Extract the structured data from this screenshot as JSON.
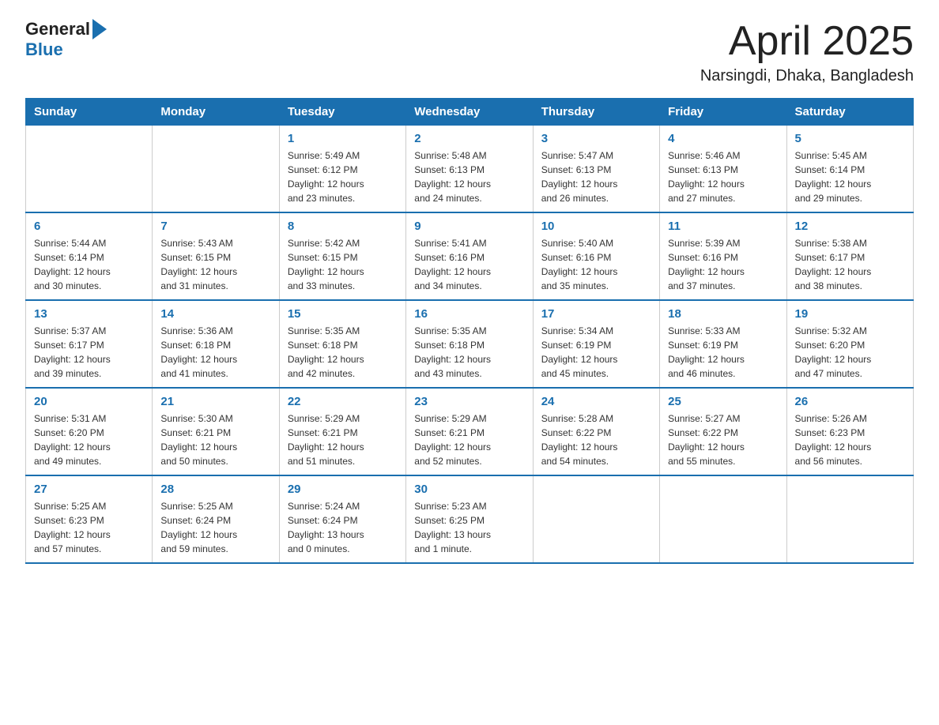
{
  "header": {
    "logo_general": "General",
    "logo_blue": "Blue",
    "month_title": "April 2025",
    "location": "Narsingdi, Dhaka, Bangladesh"
  },
  "weekdays": [
    "Sunday",
    "Monday",
    "Tuesday",
    "Wednesday",
    "Thursday",
    "Friday",
    "Saturday"
  ],
  "weeks": [
    [
      {
        "day": "",
        "info": ""
      },
      {
        "day": "",
        "info": ""
      },
      {
        "day": "1",
        "info": "Sunrise: 5:49 AM\nSunset: 6:12 PM\nDaylight: 12 hours\nand 23 minutes."
      },
      {
        "day": "2",
        "info": "Sunrise: 5:48 AM\nSunset: 6:13 PM\nDaylight: 12 hours\nand 24 minutes."
      },
      {
        "day": "3",
        "info": "Sunrise: 5:47 AM\nSunset: 6:13 PM\nDaylight: 12 hours\nand 26 minutes."
      },
      {
        "day": "4",
        "info": "Sunrise: 5:46 AM\nSunset: 6:13 PM\nDaylight: 12 hours\nand 27 minutes."
      },
      {
        "day": "5",
        "info": "Sunrise: 5:45 AM\nSunset: 6:14 PM\nDaylight: 12 hours\nand 29 minutes."
      }
    ],
    [
      {
        "day": "6",
        "info": "Sunrise: 5:44 AM\nSunset: 6:14 PM\nDaylight: 12 hours\nand 30 minutes."
      },
      {
        "day": "7",
        "info": "Sunrise: 5:43 AM\nSunset: 6:15 PM\nDaylight: 12 hours\nand 31 minutes."
      },
      {
        "day": "8",
        "info": "Sunrise: 5:42 AM\nSunset: 6:15 PM\nDaylight: 12 hours\nand 33 minutes."
      },
      {
        "day": "9",
        "info": "Sunrise: 5:41 AM\nSunset: 6:16 PM\nDaylight: 12 hours\nand 34 minutes."
      },
      {
        "day": "10",
        "info": "Sunrise: 5:40 AM\nSunset: 6:16 PM\nDaylight: 12 hours\nand 35 minutes."
      },
      {
        "day": "11",
        "info": "Sunrise: 5:39 AM\nSunset: 6:16 PM\nDaylight: 12 hours\nand 37 minutes."
      },
      {
        "day": "12",
        "info": "Sunrise: 5:38 AM\nSunset: 6:17 PM\nDaylight: 12 hours\nand 38 minutes."
      }
    ],
    [
      {
        "day": "13",
        "info": "Sunrise: 5:37 AM\nSunset: 6:17 PM\nDaylight: 12 hours\nand 39 minutes."
      },
      {
        "day": "14",
        "info": "Sunrise: 5:36 AM\nSunset: 6:18 PM\nDaylight: 12 hours\nand 41 minutes."
      },
      {
        "day": "15",
        "info": "Sunrise: 5:35 AM\nSunset: 6:18 PM\nDaylight: 12 hours\nand 42 minutes."
      },
      {
        "day": "16",
        "info": "Sunrise: 5:35 AM\nSunset: 6:18 PM\nDaylight: 12 hours\nand 43 minutes."
      },
      {
        "day": "17",
        "info": "Sunrise: 5:34 AM\nSunset: 6:19 PM\nDaylight: 12 hours\nand 45 minutes."
      },
      {
        "day": "18",
        "info": "Sunrise: 5:33 AM\nSunset: 6:19 PM\nDaylight: 12 hours\nand 46 minutes."
      },
      {
        "day": "19",
        "info": "Sunrise: 5:32 AM\nSunset: 6:20 PM\nDaylight: 12 hours\nand 47 minutes."
      }
    ],
    [
      {
        "day": "20",
        "info": "Sunrise: 5:31 AM\nSunset: 6:20 PM\nDaylight: 12 hours\nand 49 minutes."
      },
      {
        "day": "21",
        "info": "Sunrise: 5:30 AM\nSunset: 6:21 PM\nDaylight: 12 hours\nand 50 minutes."
      },
      {
        "day": "22",
        "info": "Sunrise: 5:29 AM\nSunset: 6:21 PM\nDaylight: 12 hours\nand 51 minutes."
      },
      {
        "day": "23",
        "info": "Sunrise: 5:29 AM\nSunset: 6:21 PM\nDaylight: 12 hours\nand 52 minutes."
      },
      {
        "day": "24",
        "info": "Sunrise: 5:28 AM\nSunset: 6:22 PM\nDaylight: 12 hours\nand 54 minutes."
      },
      {
        "day": "25",
        "info": "Sunrise: 5:27 AM\nSunset: 6:22 PM\nDaylight: 12 hours\nand 55 minutes."
      },
      {
        "day": "26",
        "info": "Sunrise: 5:26 AM\nSunset: 6:23 PM\nDaylight: 12 hours\nand 56 minutes."
      }
    ],
    [
      {
        "day": "27",
        "info": "Sunrise: 5:25 AM\nSunset: 6:23 PM\nDaylight: 12 hours\nand 57 minutes."
      },
      {
        "day": "28",
        "info": "Sunrise: 5:25 AM\nSunset: 6:24 PM\nDaylight: 12 hours\nand 59 minutes."
      },
      {
        "day": "29",
        "info": "Sunrise: 5:24 AM\nSunset: 6:24 PM\nDaylight: 13 hours\nand 0 minutes."
      },
      {
        "day": "30",
        "info": "Sunrise: 5:23 AM\nSunset: 6:25 PM\nDaylight: 13 hours\nand 1 minute."
      },
      {
        "day": "",
        "info": ""
      },
      {
        "day": "",
        "info": ""
      },
      {
        "day": "",
        "info": ""
      }
    ]
  ]
}
